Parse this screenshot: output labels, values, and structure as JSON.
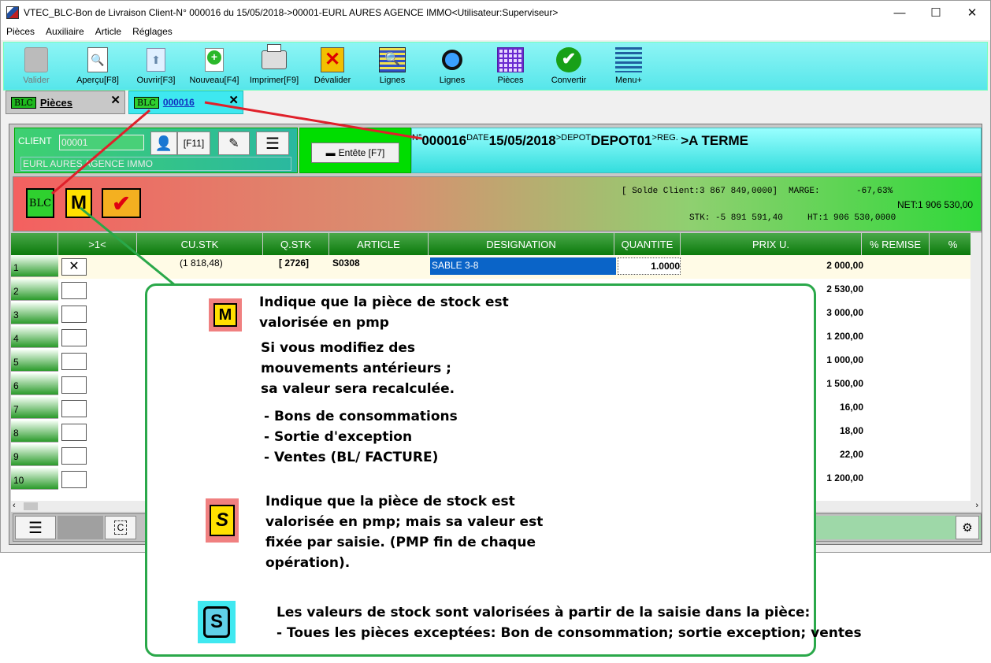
{
  "window": {
    "title": "VTEC_BLC-Bon de Livraison Client-N° 000016 du 15/05/2018->00001-EURL AURES AGENCE IMMO<Utilisateur:Superviseur>",
    "minimize": "—",
    "maximize": "☐",
    "close": "✕"
  },
  "menu": [
    "Pièces",
    "Auxiliaire",
    "Article",
    "Réglages"
  ],
  "toolbar": {
    "valider": "Valider",
    "apercu": "Aperçu[F8]",
    "ouvrir": "Ouvrir[F3]",
    "nouveau": "Nouveau[F4]",
    "imprimer": "Imprimer[F9]",
    "devalider": "Dévalider",
    "lignes1": "Lignes",
    "lignes2": "Lignes",
    "pieces": "Pièces",
    "convertir": "Convertir",
    "menu": "Menu+"
  },
  "tabs": {
    "pieces": {
      "badge": "BLC",
      "label": "Pièces",
      "close": "✕"
    },
    "doc": {
      "badge": "BLC",
      "label": "000016",
      "close": "✕"
    }
  },
  "header": {
    "client_label": "CLIENT",
    "client_code": "00001",
    "client_name": "EURL AURES AGENCE IMMO",
    "f11": "[F11]",
    "entete": "Entête [F7]",
    "num_label": "N°",
    "num": "000016",
    "date_label": "DATE",
    "date": "15/05/2018",
    "depot_label": ">DEPOT",
    "depot": "DEPOT01",
    "reg_label": ">REG.",
    "reg": ">A TERME"
  },
  "band": {
    "badge": "BLC",
    "m": "M",
    "check": "✔",
    "solde": "[ Solde Client:3 867 849,0000]",
    "marge_label": "MARGE:",
    "marge": "-67,63%",
    "net": "NET:1 906 530,00",
    "stk": "STK:  -5 891 591,40",
    "ht": "HT:1 906 530,0000"
  },
  "grid": {
    "columns": [
      "",
      ">1<",
      "CU.STK",
      "Q.STK",
      "ARTICLE",
      "DESIGNATION",
      "QUANTITE",
      "PRIX U.",
      "% REMISE",
      "%"
    ],
    "rows": [
      {
        "num": "1",
        "custk": "(1 818,48)",
        "qstk": "[ 2726]",
        "article": "S0308",
        "designation": "SABLE 3-8",
        "quantite": "1.0000",
        "prix": "2 000,00"
      },
      {
        "num": "2",
        "prix": "2 530,00"
      },
      {
        "num": "3",
        "prix": "3 000,00"
      },
      {
        "num": "4",
        "prix": "1 200,00"
      },
      {
        "num": "5",
        "prix": "1 000,00"
      },
      {
        "num": "6",
        "prix": "1 500,00"
      },
      {
        "num": "7",
        "prix": "16,00"
      },
      {
        "num": "8",
        "prix": "18,00"
      },
      {
        "num": "9",
        "prix": "22,00"
      },
      {
        "num": "10",
        "prix": "1 200,00"
      }
    ]
  },
  "callout": {
    "m_icon": "M",
    "m_line1": "Indique que la pièce de stock est",
    "m_line2": "valorisée en pmp",
    "m_line3": "Si vous modifiez des",
    "m_line4": "mouvements antérieurs ;",
    "m_line5": "sa valeur sera recalculée.",
    "list1": "- Bons de consommations",
    "list2": "- Sortie d'exception",
    "list3": "- Ventes (BL/ FACTURE)",
    "s1_icon": "S",
    "s1_line1": "Indique que la pièce de stock est",
    "s1_line2": "valorisée en pmp; mais sa valeur est",
    "s1_line3": "fixée par saisie. (PMP fin de chaque",
    "s1_line4": "opération).",
    "s2_icon": "S",
    "s2_line1": "Les valeurs de stock sont valorisées à partir de la saisie dans la pièce:",
    "s2_line2": "- Toues les pièces exceptées:  Bon de consommation; sortie exception; ventes"
  }
}
